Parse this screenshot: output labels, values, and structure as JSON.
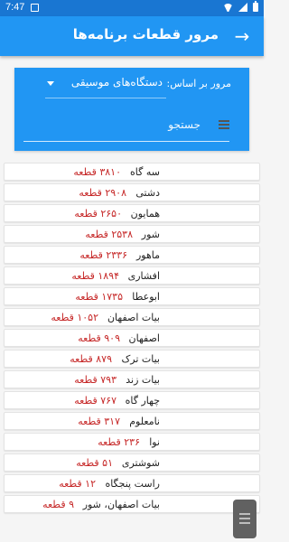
{
  "status_bar": {
    "time": "7:47",
    "icons": [
      "notification-icon",
      "wifi-icon",
      "signal-icon",
      "battery-icon"
    ]
  },
  "app_bar": {
    "title": "مرور قطعات برنامه‌ها",
    "back_icon": "arrow-forward-icon"
  },
  "filter": {
    "label": "مرور بر اساس:",
    "selected": "دستگاه‌های موسیقی"
  },
  "search": {
    "placeholder": "جستجو",
    "icon": "menu-icon"
  },
  "items": [
    {
      "name": "سه گاه",
      "count": "۳۸۱۰ قطعه"
    },
    {
      "name": "دشتی",
      "count": "۲۹۰۸ قطعه"
    },
    {
      "name": "همایون",
      "count": "۲۶۵۰ قطعه"
    },
    {
      "name": "شور",
      "count": "۲۵۳۸ قطعه"
    },
    {
      "name": "ماهور",
      "count": "۲۳۳۶ قطعه"
    },
    {
      "name": "افشاری",
      "count": "۱۸۹۴ قطعه"
    },
    {
      "name": "ابوعطا",
      "count": "۱۷۳۵ قطعه"
    },
    {
      "name": "بیات اصفهان",
      "count": "۱۰۵۲ قطعه"
    },
    {
      "name": "اصفهان",
      "count": "۹۰۹ قطعه"
    },
    {
      "name": "بیات ترک",
      "count": "۸۷۹ قطعه"
    },
    {
      "name": "بیات زند",
      "count": "۷۹۳ قطعه"
    },
    {
      "name": "چهار گاه",
      "count": "۷۶۷ قطعه"
    },
    {
      "name": "نامعلوم",
      "count": "۳۱۷ قطعه"
    },
    {
      "name": "نوا",
      "count": "۲۳۶ قطعه"
    },
    {
      "name": "شوشتری",
      "count": "۵۱ قطعه"
    },
    {
      "name": "راست پنجگاه",
      "count": "۱۲ قطعه"
    },
    {
      "name": "بیات اصفهان، شور",
      "count": "۹ قطعه"
    }
  ],
  "colors": {
    "status_bar": "#1976d2",
    "primary": "#2196f3",
    "count_text": "#c62828"
  }
}
